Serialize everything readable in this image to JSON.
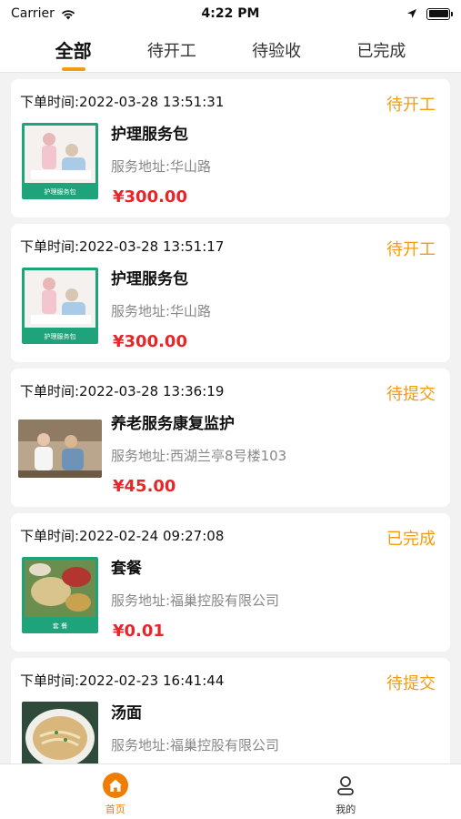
{
  "status_bar": {
    "carrier": "Carrier",
    "time": "4:22 PM"
  },
  "tabs": [
    {
      "label": "全部",
      "active": true
    },
    {
      "label": "待开工",
      "active": false
    },
    {
      "label": "待验收",
      "active": false
    },
    {
      "label": "已完成",
      "active": false
    }
  ],
  "orders": [
    {
      "time": "下单时间:2022-03-28 13:51:31",
      "status": "待开工",
      "title": "护理服务包",
      "address": "服务地址:华山路",
      "price": "¥300.00",
      "thumb_caption": "护理服务包"
    },
    {
      "time": "下单时间:2022-03-28 13:51:17",
      "status": "待开工",
      "title": "护理服务包",
      "address": "服务地址:华山路",
      "price": "¥300.00",
      "thumb_caption": "护理服务包"
    },
    {
      "time": "下单时间:2022-03-28 13:36:19",
      "status": "待提交",
      "title": "养老服务康复监护",
      "address": "服务地址:西湖兰亭8号楼103",
      "price": "¥45.00"
    },
    {
      "time": "下单时间:2022-02-24 09:27:08",
      "status": "已完成",
      "title": "套餐",
      "address": "服务地址:福巢控股有限公司",
      "price": "¥0.01",
      "thumb_caption": "套 餐"
    },
    {
      "time": "下单时间:2022-02-23 16:41:44",
      "status": "待提交",
      "title": "汤面",
      "address": "服务地址:福巢控股有限公司",
      "price": ""
    }
  ],
  "bottom_nav": [
    {
      "label": "首页",
      "icon": "home-icon",
      "active": true
    },
    {
      "label": "我的",
      "icon": "profile-icon",
      "active": false
    }
  ],
  "colors": {
    "accent": "#f39c12",
    "price": "#e8262a",
    "nav_active": "#f07c00"
  }
}
